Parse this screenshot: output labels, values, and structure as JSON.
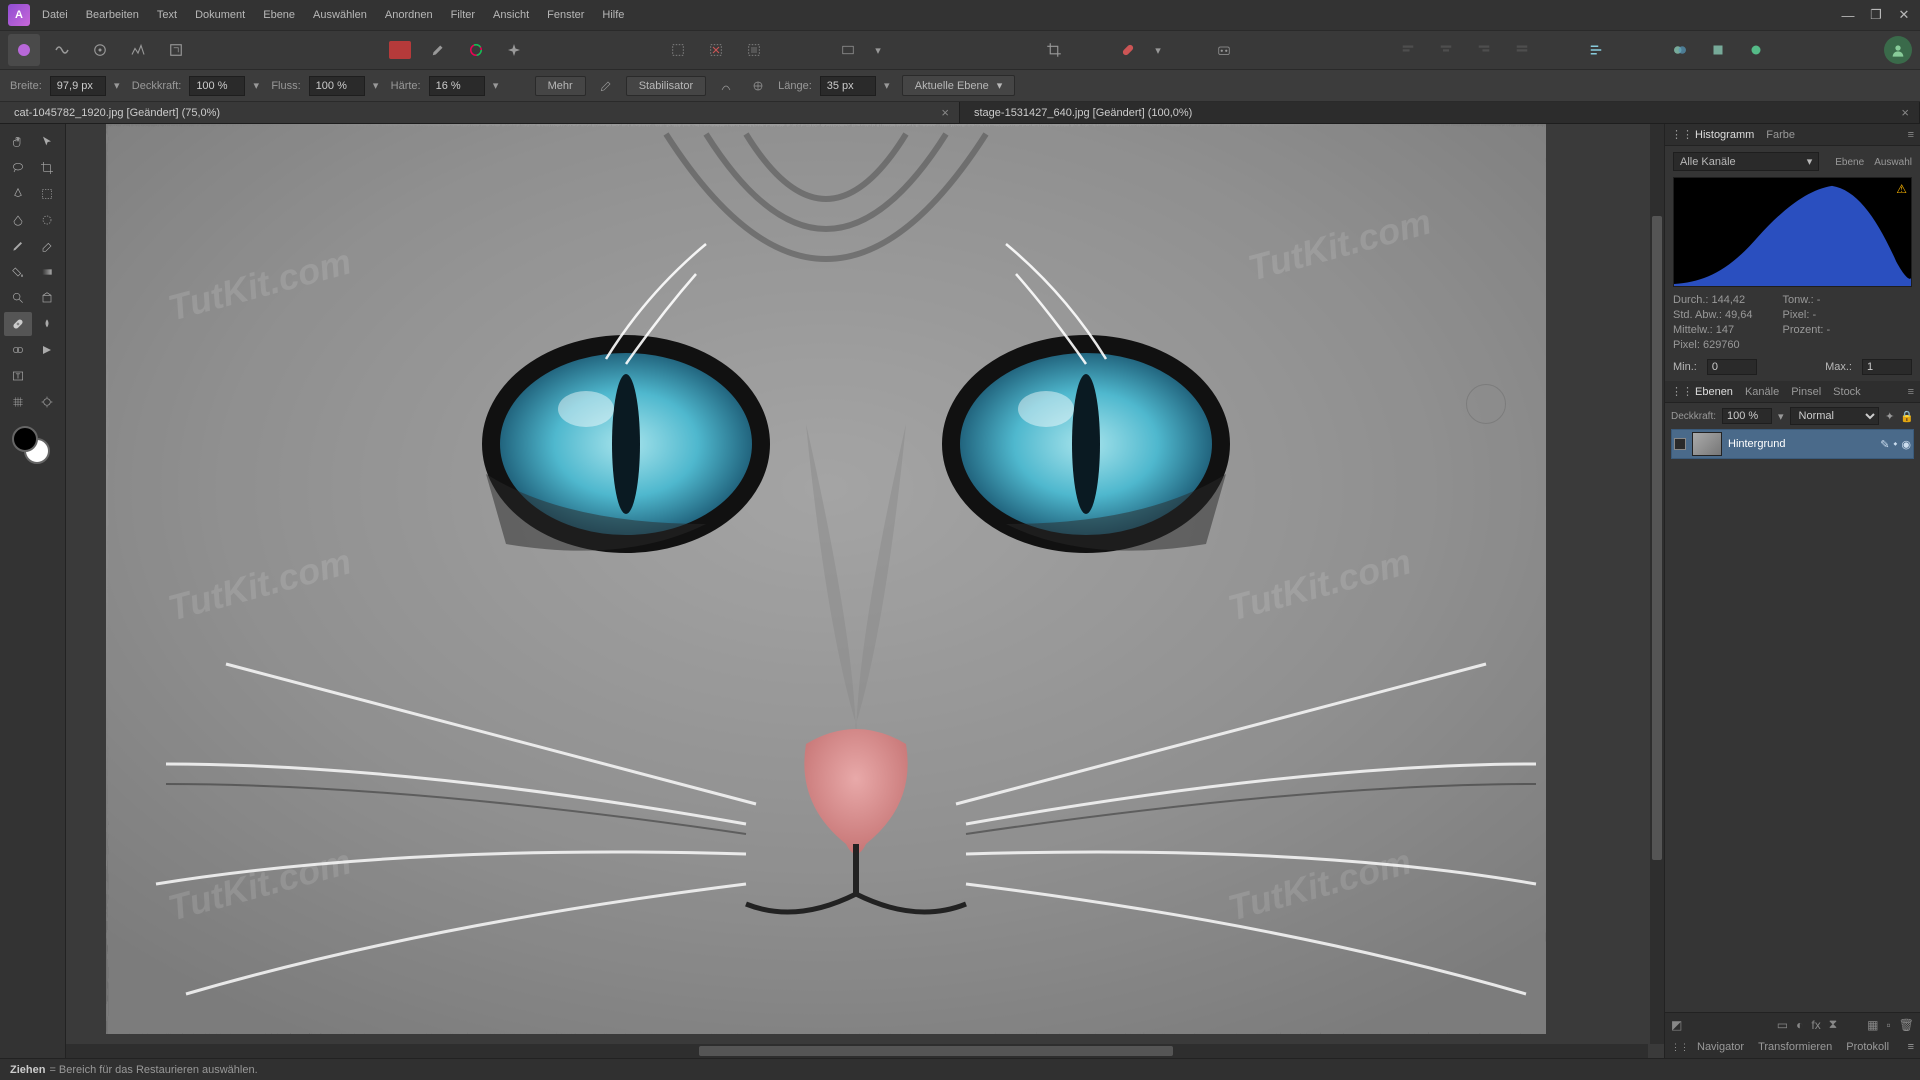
{
  "menu": [
    "Datei",
    "Bearbeiten",
    "Text",
    "Dokument",
    "Ebene",
    "Auswählen",
    "Anordnen",
    "Filter",
    "Ansicht",
    "Fenster",
    "Hilfe"
  ],
  "context": {
    "breite_lbl": "Breite:",
    "breite_val": "97,9 px",
    "deck_lbl": "Deckkraft:",
    "deck_val": "100 %",
    "fluss_lbl": "Fluss:",
    "fluss_val": "100 %",
    "haerte_lbl": "Härte:",
    "haerte_val": "16 %",
    "mehr": "Mehr",
    "stabil": "Stabilisator",
    "laenge_lbl": "Länge:",
    "laenge_val": "35 px",
    "layer_dd": "Aktuelle Ebene"
  },
  "tabs": [
    {
      "label": "cat-1045782_1920.jpg [Geändert] (75,0%)",
      "active": true
    },
    {
      "label": "stage-1531427_640.jpg [Geändert] (100,0%)",
      "active": false
    }
  ],
  "histo": {
    "tab1": "Histogramm",
    "tab2": "Farbe",
    "channels": "Alle Kanäle",
    "mode1": "Ebene",
    "mode2": "Auswahl",
    "stats": {
      "durch": "Durch.: 144,42",
      "std": "Std. Abw.: 49,64",
      "mittel": "Mittelw.: 147",
      "pixel": "Pixel: 629760",
      "tonw": "Tonw.: -",
      "pix": "Pixel: -",
      "proz": "Prozent: -"
    },
    "min_lbl": "Min.:",
    "min_val": "0",
    "max_lbl": "Max.:",
    "max_val": "1"
  },
  "layers_panel": {
    "tabs": [
      "Ebenen",
      "Kanäle",
      "Pinsel",
      "Stock"
    ],
    "deck_lbl": "Deckkraft:",
    "deck_val": "100 %",
    "blend": "Normal",
    "layer_name": "Hintergrund"
  },
  "bottom_tabs": [
    "Navigator",
    "Transformieren",
    "Protokoll"
  ],
  "status_action": "Ziehen",
  "status_hint": " = Bereich für das Restaurieren auswählen.",
  "watermark": "TutKit.com"
}
